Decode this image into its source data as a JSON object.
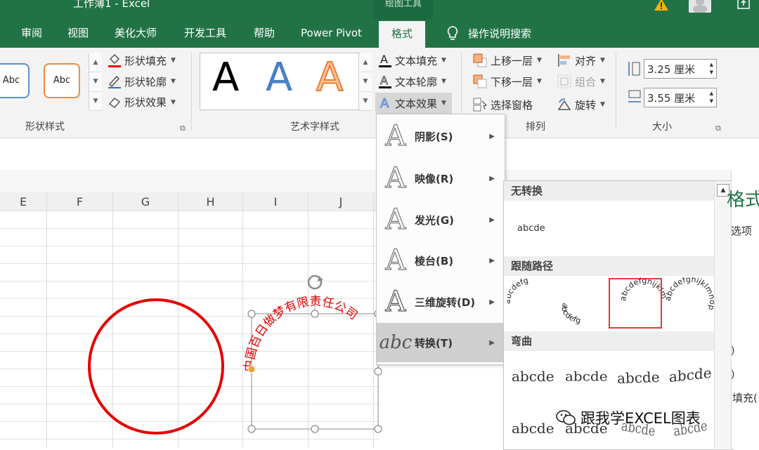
{
  "window": {
    "title": "工作薄1  -  Excel",
    "context_tab_group": "绘图工具"
  },
  "tabs": [
    {
      "label": "审阅"
    },
    {
      "label": "视图"
    },
    {
      "label": "美化大师"
    },
    {
      "label": "开发工具"
    },
    {
      "label": "帮助"
    },
    {
      "label": "Power Pivot"
    },
    {
      "label": "格式"
    }
  ],
  "tell_me": "操作说明搜索",
  "ribbon": {
    "shape_styles": {
      "label": "形状样式",
      "samples": [
        "Abc",
        "Abc"
      ],
      "fill": "形状填充",
      "outline": "形状轮廓",
      "effects": "形状效果"
    },
    "wordart_styles": {
      "label": "艺术字样式",
      "samples": [
        "A",
        "A",
        "A"
      ],
      "text_fill": "文本填充",
      "text_outline": "文本轮廓",
      "text_effects": "文本效果"
    },
    "arrange": {
      "label": "排列",
      "bring_forward": "上移一层",
      "send_backward": "下移一层",
      "selection_pane": "选择窗格",
      "align": "对齐",
      "group": "组合",
      "rotate": "旋转"
    },
    "size": {
      "label": "大小",
      "height": "3.25 厘米",
      "width": "3.55 厘米"
    }
  },
  "columns": [
    "E",
    "F",
    "G",
    "H",
    "I",
    "J"
  ],
  "text_effects_menu": [
    {
      "icon": "A",
      "label": "阴影(S)"
    },
    {
      "icon": "A",
      "label": "映像(R)"
    },
    {
      "icon": "A",
      "label": "发光(G)"
    },
    {
      "icon": "A",
      "label": "棱台(B)"
    },
    {
      "icon": "A",
      "label": "三维旋转(D)"
    },
    {
      "icon": "abc",
      "label": "转换(T)"
    }
  ],
  "transform_submenu": {
    "no_transform": {
      "header": "无转换",
      "sample": "abcde"
    },
    "follow_path": {
      "header": "跟随路径",
      "samples": [
        "abcdefg",
        "abcdefg",
        "abcdefghijklm",
        "abcdefghijklmnop"
      ]
    },
    "warp": {
      "header": "弯曲",
      "samples": [
        "abcde",
        "abcde",
        "abcde",
        "abcde",
        "abcde",
        "abcde",
        "abcde",
        "abcde"
      ]
    }
  },
  "shape": {
    "arc_text": "中国百日做梦有限责任公司"
  },
  "right_pane": {
    "title_fragment": "格式",
    "options_fragment": "选项",
    "fill_fragment": "填充("
  },
  "watermark": "跟我学EXCEL图表",
  "colors": {
    "excel_green": "#217346",
    "circle_red": "#e60000",
    "selection_red": "#e53935",
    "handle_orange": "#f0a030"
  }
}
